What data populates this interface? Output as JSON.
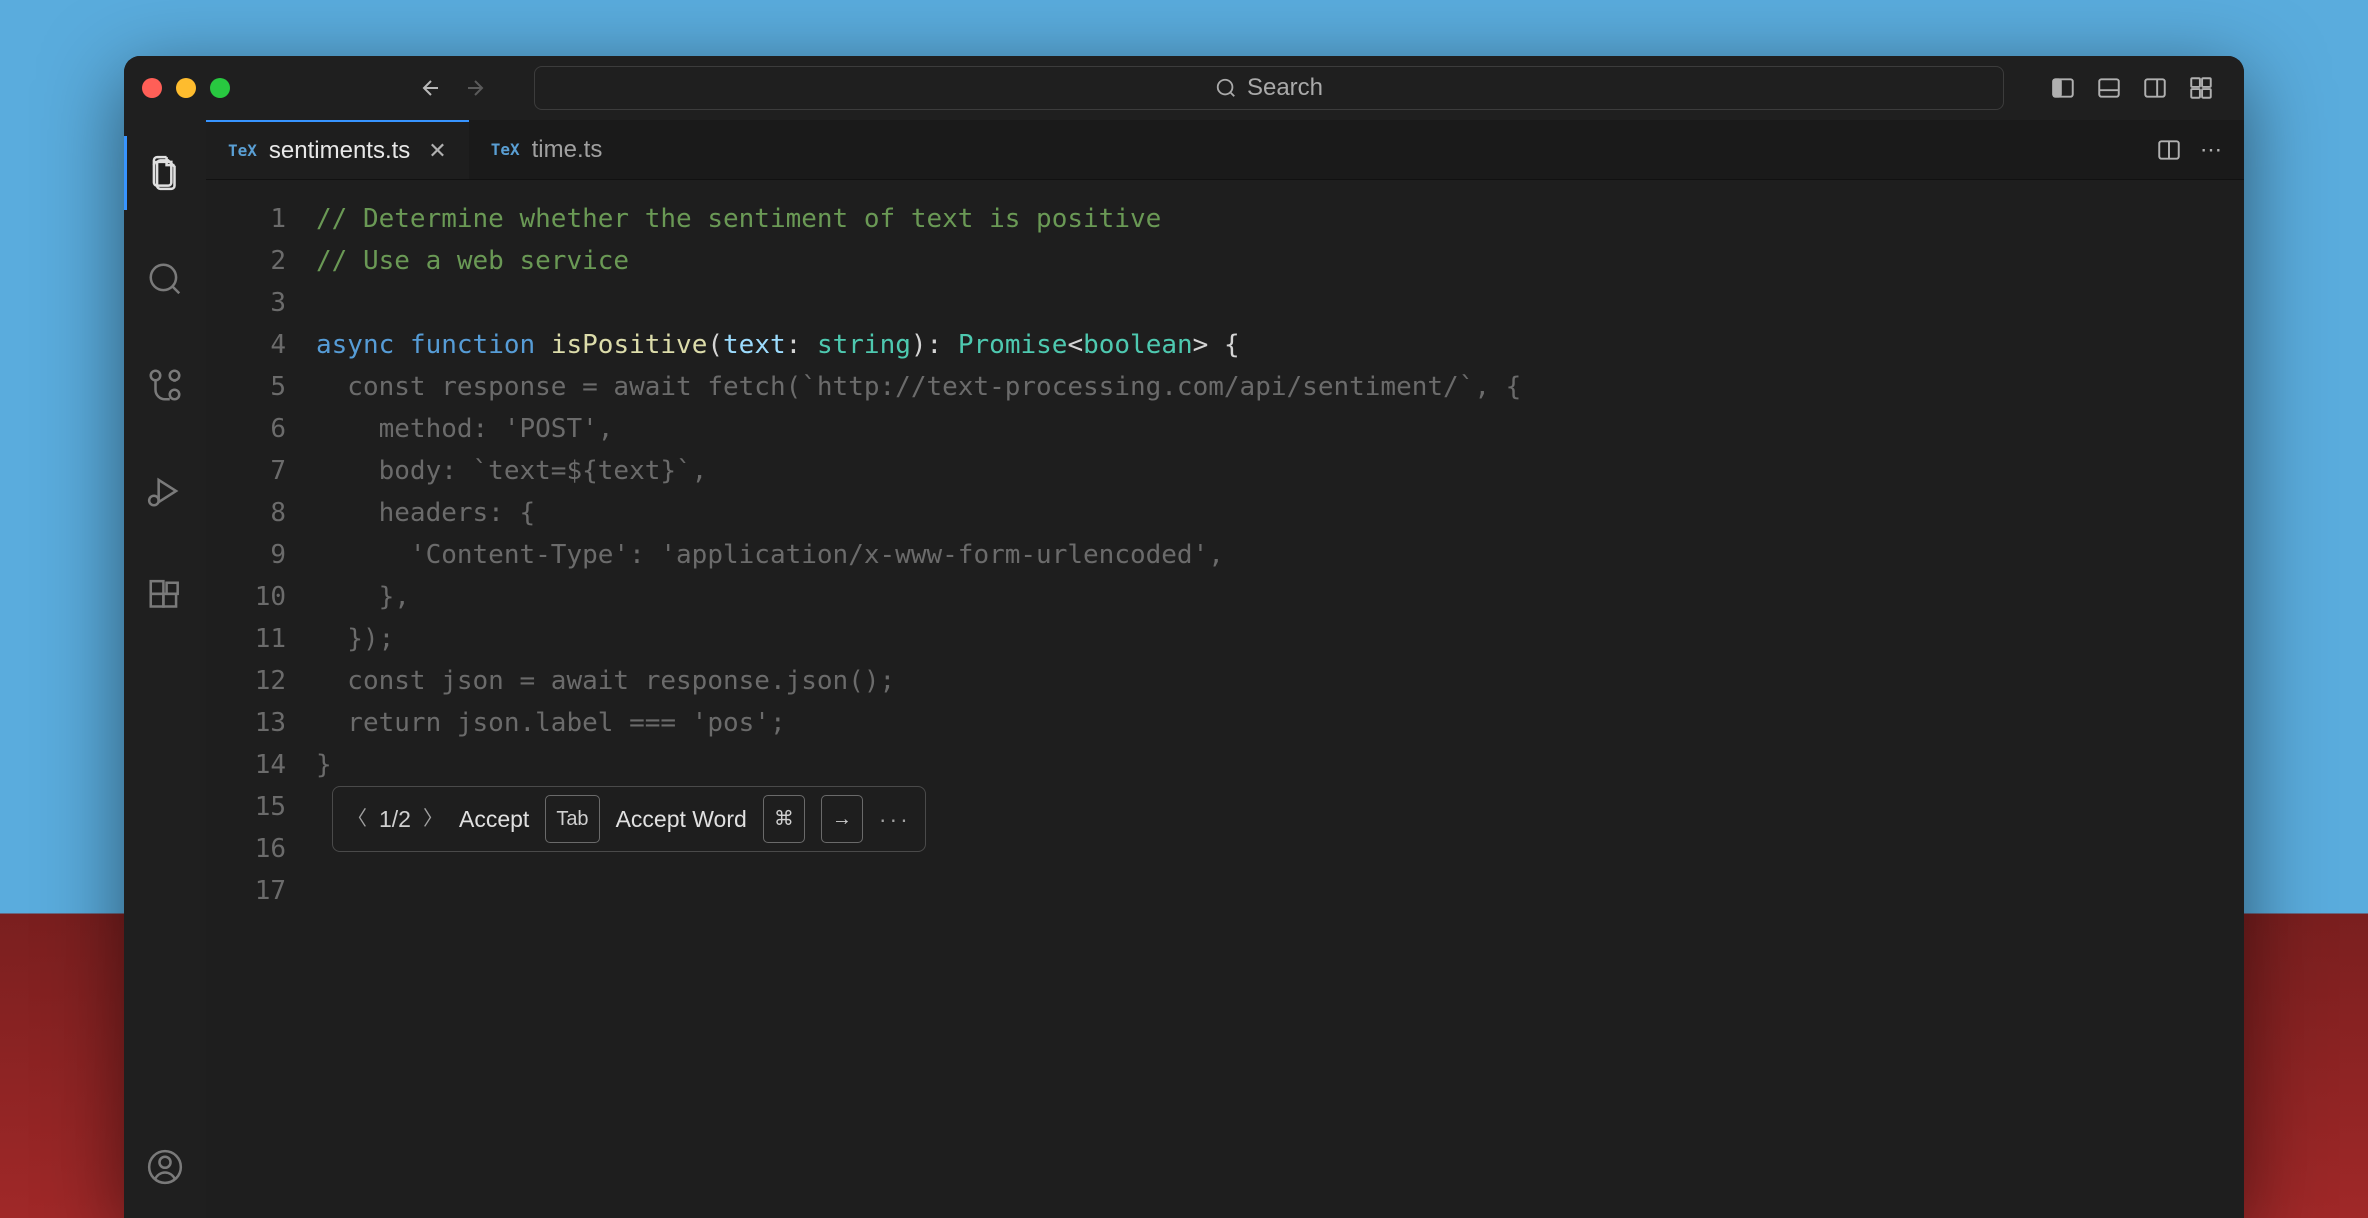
{
  "search": {
    "placeholder": "Search"
  },
  "tabs": [
    {
      "name": "sentiments.ts",
      "active": true,
      "icon": "TeX"
    },
    {
      "name": "time.ts",
      "active": false,
      "icon": "TeX"
    }
  ],
  "code": {
    "lines": [
      {
        "n": 1,
        "t": "comment",
        "text": "// Determine whether the sentiment of text is positive"
      },
      {
        "n": 2,
        "t": "comment",
        "text": "// Use a web service"
      },
      {
        "n": 3,
        "t": "blank",
        "text": ""
      },
      {
        "n": 4,
        "t": "sig"
      },
      {
        "n": 5,
        "t": "g",
        "text": "  const response = await fetch(`http://text-processing.com/api/sentiment/`, {"
      },
      {
        "n": 6,
        "t": "g",
        "text": "    method: 'POST',"
      },
      {
        "n": 7,
        "t": "g",
        "text": "    body: `text=${text}`,"
      },
      {
        "n": 8,
        "t": "g",
        "text": "    headers: {"
      },
      {
        "n": 9,
        "t": "g",
        "text": "      'Content-Type': 'application/x-www-form-urlencoded',"
      },
      {
        "n": 10,
        "t": "g",
        "text": "    },"
      },
      {
        "n": 11,
        "t": "g",
        "text": "  });"
      },
      {
        "n": 12,
        "t": "g",
        "text": "  const json = await response.json();"
      },
      {
        "n": 13,
        "t": "g",
        "text": "  return json.label === 'pos';"
      },
      {
        "n": 14,
        "t": "g",
        "text": "}"
      },
      {
        "n": 15,
        "t": "blank",
        "text": ""
      },
      {
        "n": 16,
        "t": "blank",
        "text": ""
      },
      {
        "n": 17,
        "t": "blank",
        "text": ""
      }
    ],
    "sig": {
      "async": "async",
      "function": "function",
      "name": "isPositive",
      "param": "text",
      "ptype": "string",
      "ret": "Promise",
      "rettype": "boolean"
    }
  },
  "suggestion": {
    "counter": "1/2",
    "accept": "Accept",
    "accept_key": "Tab",
    "accept_word": "Accept Word",
    "word_key1": "⌘",
    "word_key2": "→"
  }
}
